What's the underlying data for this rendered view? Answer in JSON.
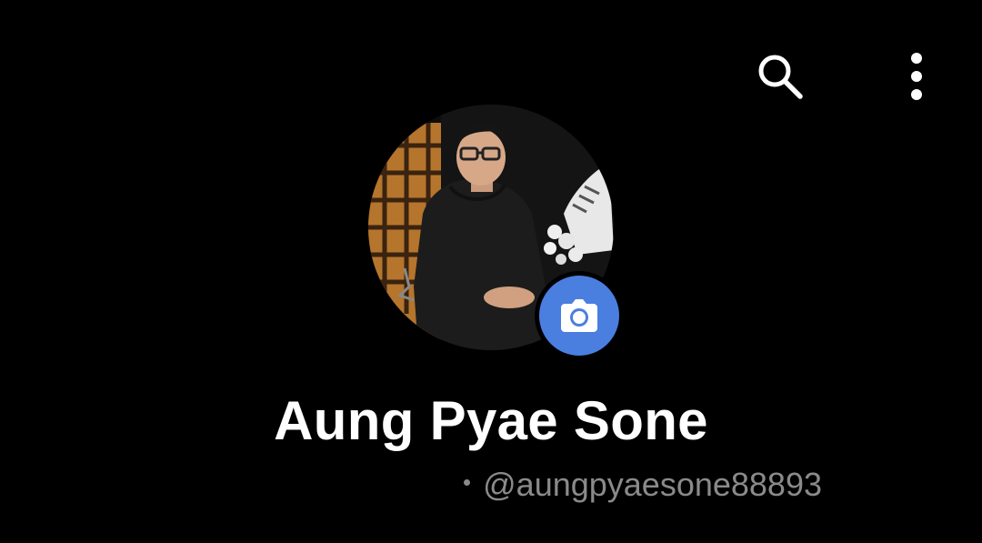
{
  "header": {
    "search_icon": "search-icon",
    "more_icon": "more-vert-icon"
  },
  "profile": {
    "avatar_icon": "profile-photo",
    "camera_icon": "camera-icon",
    "name": "Aung Pyae Sone",
    "username": "@aungpyaesone88893"
  },
  "colors": {
    "background": "#000000",
    "text_primary": "#ffffff",
    "text_secondary": "#8a8a8a",
    "accent": "#4a7fe0"
  }
}
